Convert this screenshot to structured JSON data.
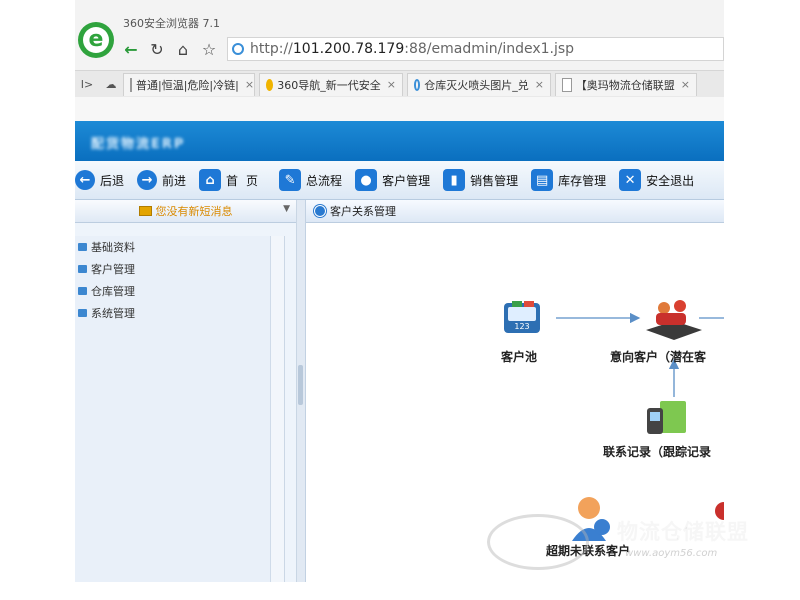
{
  "browser": {
    "title": "360安全浏览器 7.1",
    "url_scheme": "http://",
    "url_host": "101.200.78.179",
    "url_rest": ":88/emadmin/index1.jsp",
    "tab_nav": "I>",
    "tabs": [
      {
        "label": "普通|恒温|危险|冷链|",
        "close": "×"
      },
      {
        "label": "360导航_新一代安全",
        "close": "×"
      },
      {
        "label": "仓库灭火喷头图片_兑",
        "close": "×"
      },
      {
        "label": "【奥玛物流仓储联盟",
        "close": "×"
      }
    ]
  },
  "app": {
    "name": "配货物流ERP",
    "toolbar": [
      {
        "icon": "back-arrow-icon",
        "glyph": "←",
        "label": "后退"
      },
      {
        "icon": "forward-arrow-icon",
        "glyph": "→",
        "label": "前进"
      },
      {
        "icon": "home-icon",
        "glyph": "⌂",
        "label": "首页"
      },
      {
        "icon": "wrench-icon",
        "glyph": "✎",
        "label": "总流程"
      },
      {
        "icon": "customers-icon",
        "glyph": "●",
        "label": "客户管理"
      },
      {
        "icon": "chart-icon",
        "glyph": "▮",
        "label": "销售管理"
      },
      {
        "icon": "clipboard-icon",
        "glyph": "▤",
        "label": "库存管理"
      },
      {
        "icon": "exit-x-icon",
        "glyph": "✕",
        "label": "安全退出"
      }
    ]
  },
  "left": {
    "message": "您没有新短消息",
    "tree": [
      "基础资料",
      "客户管理",
      "仓库管理",
      "系统管理"
    ]
  },
  "main": {
    "header": "客户关系管理",
    "nodes": {
      "pool": "客户池",
      "intent": "意向客户（潜在客",
      "contact": "联系记录（跟踪记录",
      "overdue": "超期未联系客户"
    }
  },
  "watermark": {
    "text": "物流仓储联盟",
    "url": "www.aoym56.com"
  },
  "colors": {
    "banner": "#0a6fbf",
    "toolbar_icon": "#1e78d6",
    "message": "#d98a00",
    "arrow": "#5b8fc7"
  }
}
